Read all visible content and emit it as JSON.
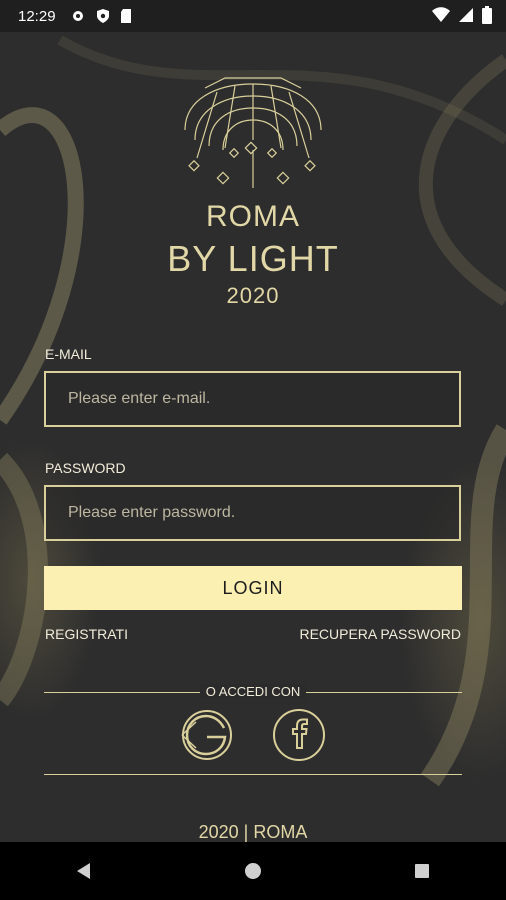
{
  "status_bar": {
    "time": "12:29",
    "left_icons": [
      "gear-icon",
      "shield-icon",
      "sd-card-icon"
    ],
    "right_icons": [
      "wifi-icon",
      "signal-icon",
      "battery-icon"
    ]
  },
  "brand": {
    "line1": "ROMA",
    "line2": "BY LIGHT",
    "line3": "2020"
  },
  "form": {
    "email_label": "E-MAIL",
    "email_placeholder": "Please enter e-mail.",
    "password_label": "PASSWORD",
    "password_placeholder": "Please enter password.",
    "login_label": "LOGIN",
    "register_label": "REGISTRATI",
    "recover_label": "RECUPERA PASSWORD"
  },
  "social": {
    "or_label": "O ACCEDI CON",
    "providers": [
      "google-icon",
      "facebook-icon"
    ]
  },
  "footer": {
    "logo_text": "2020 | ROMA"
  },
  "colors": {
    "accent": "#d9cf9a",
    "button": "#fbf0b1",
    "background": "#2b2b2b"
  }
}
